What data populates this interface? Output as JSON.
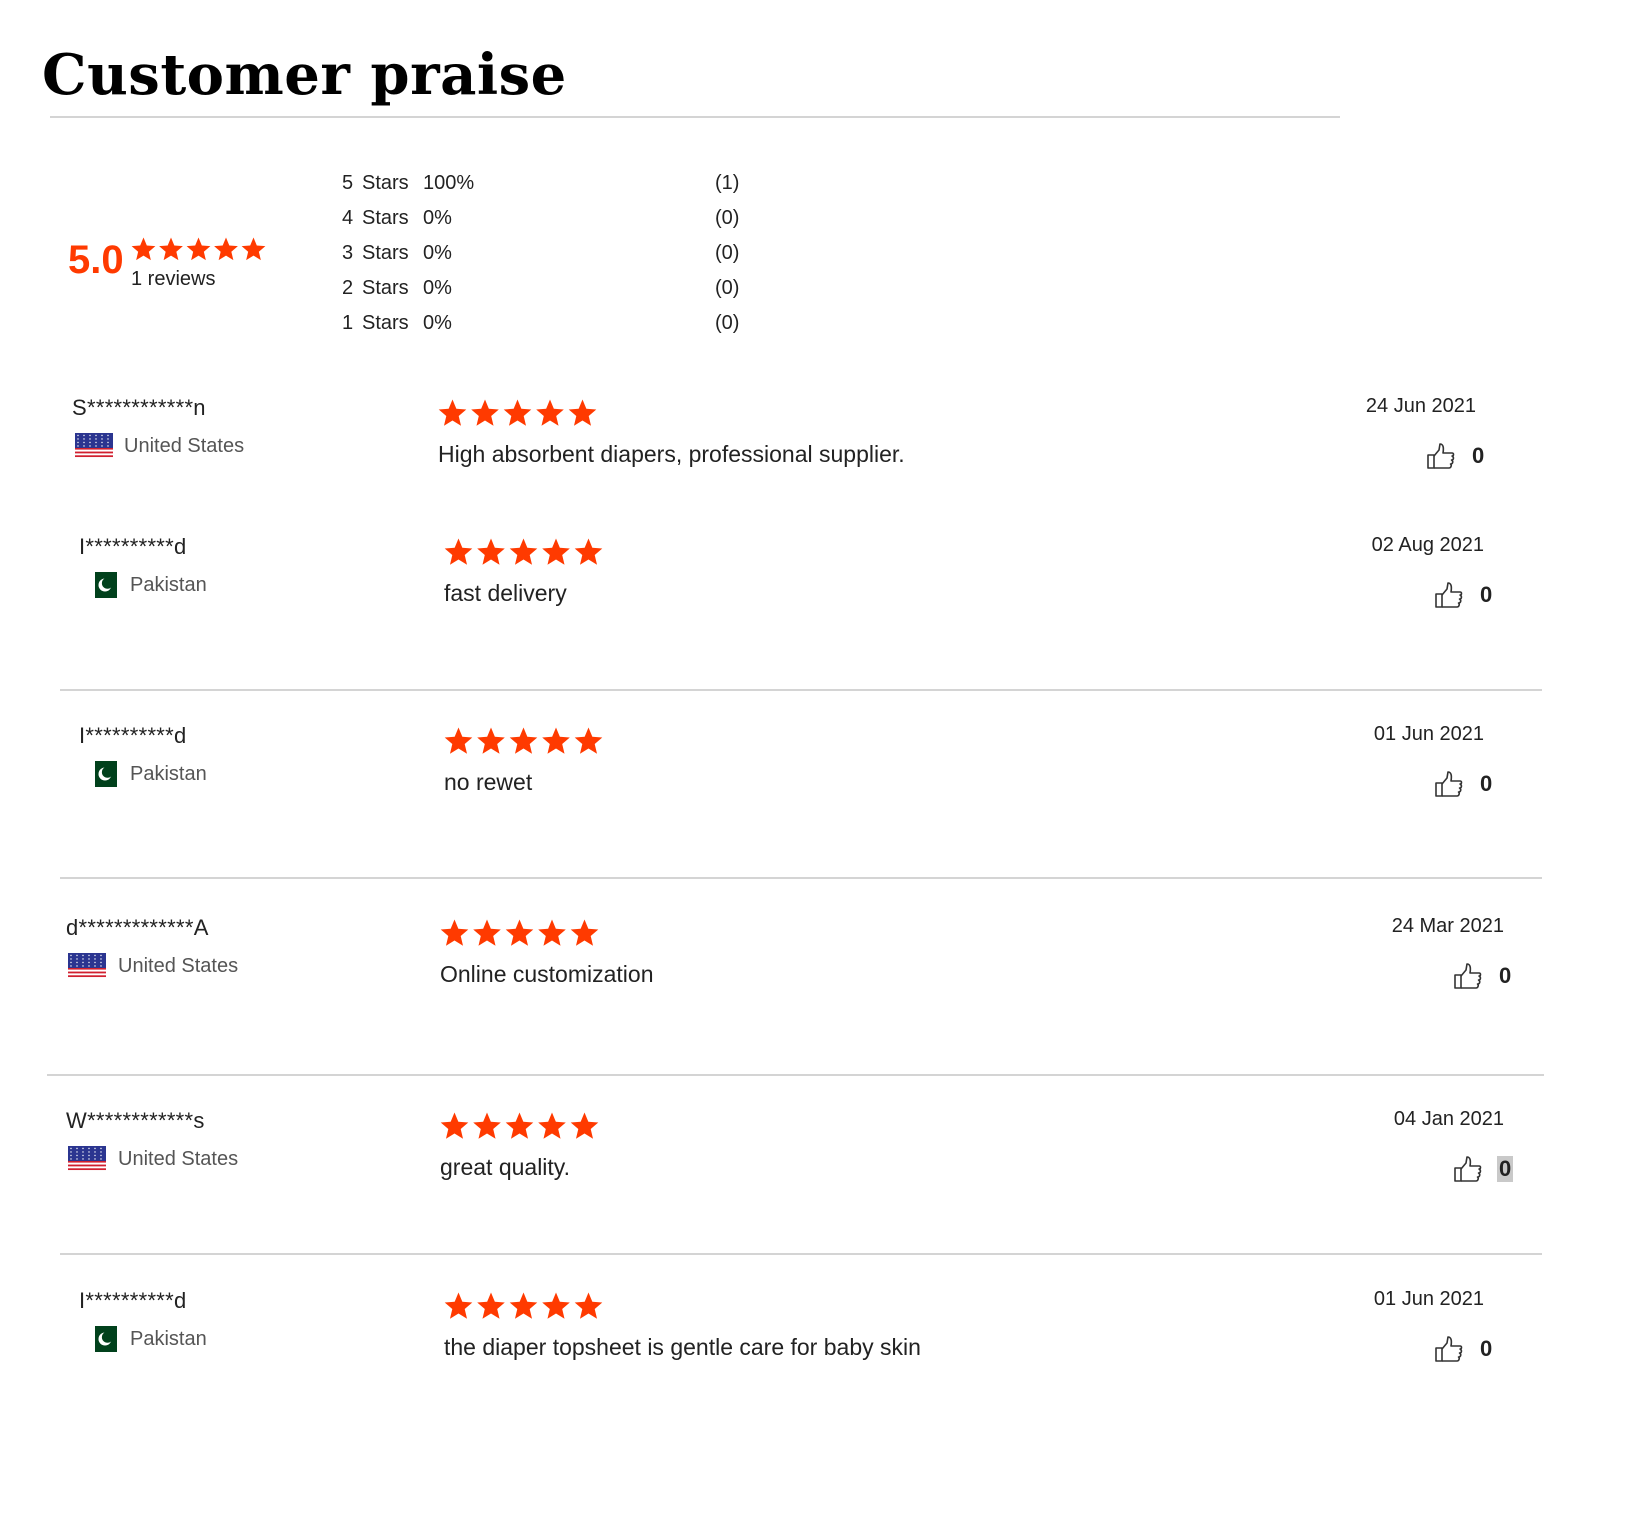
{
  "page": {
    "title": "Customer praise",
    "accent_color": "#ff3a00"
  },
  "summary": {
    "score": "5.0",
    "rating": 5,
    "max_rating": 5,
    "reviews_label": "1 reviews",
    "distribution": [
      {
        "level": "5",
        "stars_label": "Stars",
        "percent": "100%",
        "count": "(1)"
      },
      {
        "level": "4",
        "stars_label": "Stars",
        "percent": "0%",
        "count": "(0)"
      },
      {
        "level": "3",
        "stars_label": "Stars",
        "percent": "0%",
        "count": "(0)"
      },
      {
        "level": "2",
        "stars_label": "Stars",
        "percent": "0%",
        "count": "(0)"
      },
      {
        "level": "1",
        "stars_label": "Stars",
        "percent": "0%",
        "count": "(0)"
      }
    ]
  },
  "reviews": [
    {
      "name": "S************n",
      "country": "United States",
      "flag": "us-flag-icon",
      "rating": 5,
      "text": "High absorbent diapers, professional supplier.",
      "date": "24 Jun 2021",
      "likes": "0"
    },
    {
      "name": "I**********d",
      "country": "Pakistan",
      "flag": "pk-flag-icon",
      "rating": 5,
      "text": "fast delivery",
      "date": "02 Aug 2021",
      "likes": "0"
    },
    {
      "name": "I**********d",
      "country": "Pakistan",
      "flag": "pk-flag-icon",
      "rating": 5,
      "text": "no rewet",
      "date": "01 Jun 2021",
      "likes": "0"
    },
    {
      "name": "d*************A",
      "country": "United States",
      "flag": "us-flag-icon",
      "rating": 5,
      "text": "Online customization",
      "date": "24 Mar 2021",
      "likes": "0"
    },
    {
      "name": "W************s",
      "country": "United States",
      "flag": "us-flag-icon",
      "rating": 5,
      "text": "great quality.",
      "date": "04 Jan 2021",
      "likes": "0",
      "likes_highlighted": true
    },
    {
      "name": "I**********d",
      "country": "Pakistan",
      "flag": "pk-flag-icon",
      "rating": 5,
      "text": "the diaper topsheet is gentle care for baby skin",
      "date": "01 Jun 2021",
      "likes": "0"
    }
  ]
}
